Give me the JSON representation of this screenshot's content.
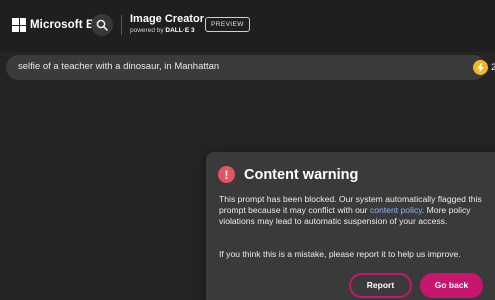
{
  "header": {
    "brand": "Microsoft Bing",
    "app_title": "Image Creator",
    "subtitle_prefix": "powered by",
    "subtitle_model": "DALL·E 3",
    "preview_badge": "PREVIEW"
  },
  "prompt": {
    "text": "selfie of a teacher with a dinosaur, in Manhattan"
  },
  "boosts": {
    "count": "2",
    "icon": "lightning-icon",
    "color": "#f3b61f"
  },
  "dialog": {
    "title": "Content warning",
    "icon": "exclamation-icon",
    "icon_color": "#e4535f",
    "body_before_link": "This prompt has been blocked. Our system automatically flagged this prompt because it may conflict with our ",
    "link_text": "content policy",
    "body_after_link": ". More policy violations may lead to automatic suspension of your access.",
    "note": "If you think this is a mistake, please report it to help us improve.",
    "report_label": "Report",
    "back_label": "Go back",
    "accent_color": "#c8156f"
  }
}
